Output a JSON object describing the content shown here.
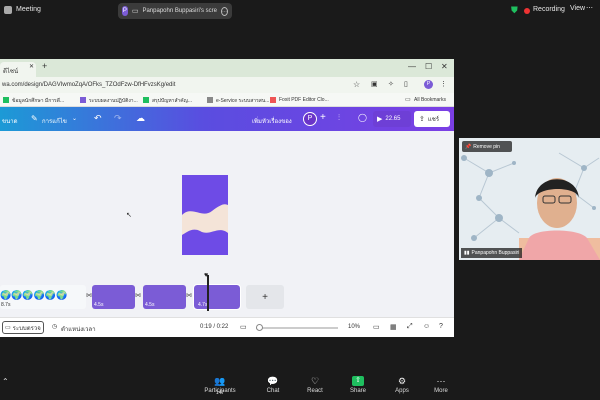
{
  "zoom_top": {
    "meeting_label": "Meeting",
    "share_label": "Panpapohn Buppasiri's scre",
    "share_avatar": "P",
    "recording_label": "Recording",
    "view_label": "View"
  },
  "browser": {
    "tab_title": "ดีไซน์",
    "url": "wa.com/design/DAGVIwmoZqA/OFks_TZOdFzw-DfHFvzsKg/edit",
    "profile": "P",
    "bookmarks": [
      "ข้อมูลนักศึกษา มีการดี...",
      "ระบบผลงานปฏิบัติงา...",
      "สรุปปัญหาสำคัญ...",
      "e-Service ระบบสารสน...",
      "Foxit PDF Editor Clo..."
    ],
    "all_bookmarks": "All Bookmarks"
  },
  "canva": {
    "file_label": "ขนาด",
    "edit_label": "การแก้ไข",
    "doc_title": "เพิ่มหัวเรื่องของ",
    "avatar": "P",
    "play_time": "22.65",
    "share_label": "แชร์"
  },
  "timeline": {
    "clip_durations": [
      "8.7s",
      "4.5s",
      "4.5s",
      "4.7s"
    ],
    "add_label": "+"
  },
  "footer": {
    "notes_label": "ระบบตรวจ",
    "duration_label": "ตำแหน่งเวลา",
    "time": "0:19 / 0:22",
    "zoom": "10%"
  },
  "video_tile": {
    "remove_pin": "Remove pin",
    "participant_name": "Panpapohn Buppasiri"
  },
  "bottom_bar": {
    "participants_count": "147",
    "items": [
      "Participants",
      "Chat",
      "React",
      "Share",
      "Apps",
      "More"
    ]
  },
  "colors": {
    "accent_purple": "#7b5cd6",
    "share_green": "#1fbf5f"
  }
}
